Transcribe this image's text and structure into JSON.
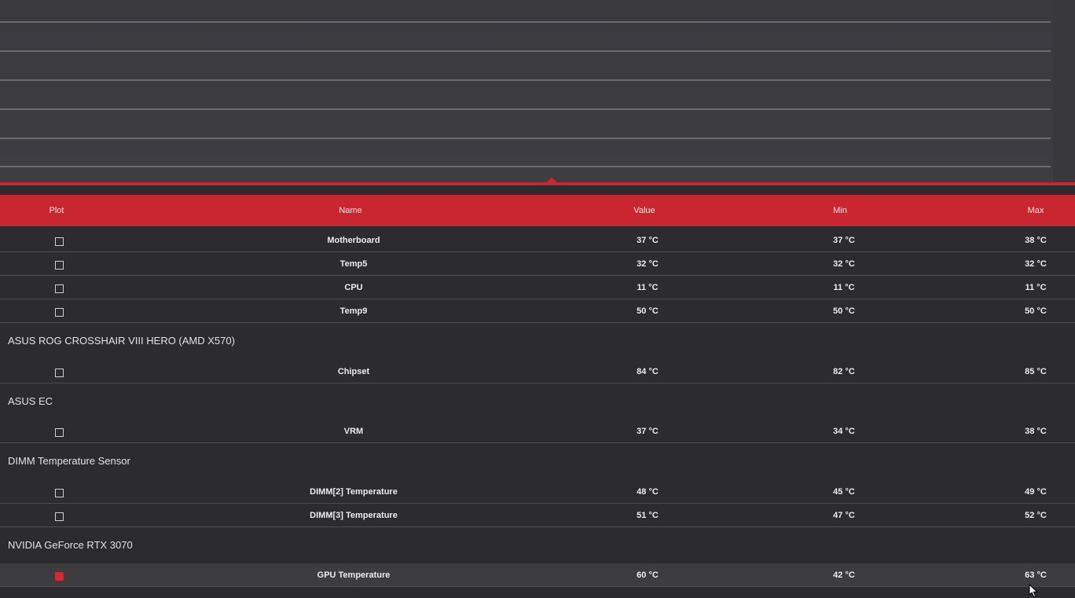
{
  "columns": {
    "plot": "Plot",
    "name": "Name",
    "value": "Value",
    "min": "Min",
    "max": "Max"
  },
  "rows": [
    {
      "name": "Motherboard",
      "value": "37 °C",
      "min": "37 °C",
      "max": "38 °C",
      "plotted": false
    },
    {
      "name": "Temp5",
      "value": "32 °C",
      "min": "32 °C",
      "max": "32 °C",
      "plotted": false
    },
    {
      "name": "CPU",
      "value": "11 °C",
      "min": "11 °C",
      "max": "11 °C",
      "plotted": false
    },
    {
      "name": "Temp9",
      "value": "50 °C",
      "min": "50 °C",
      "max": "50 °C",
      "plotted": false
    }
  ],
  "groups": [
    {
      "title": "ASUS ROG CROSSHAIR VIII HERO (AMD X570)",
      "rows": [
        {
          "name": "Chipset",
          "value": "84 °C",
          "min": "82 °C",
          "max": "85 °C",
          "plotted": false
        }
      ]
    },
    {
      "title": "ASUS EC",
      "rows": [
        {
          "name": "VRM",
          "value": "37 °C",
          "min": "34 °C",
          "max": "38 °C",
          "plotted": false
        }
      ]
    },
    {
      "title": "DIMM Temperature Sensor",
      "rows": [
        {
          "name": "DIMM[2] Temperature",
          "value": "48 °C",
          "min": "45 °C",
          "max": "49 °C",
          "plotted": false
        },
        {
          "name": "DIMM[3] Temperature",
          "value": "51 °C",
          "min": "47 °C",
          "max": "52 °C",
          "plotted": false
        }
      ]
    },
    {
      "title": "NVIDIA GeForce RTX 3070",
      "rows": [
        {
          "name": "GPU Temperature",
          "value": "60 °C",
          "min": "42 °C",
          "max": "63 °C",
          "plotted": true
        }
      ]
    }
  ],
  "colors": {
    "accent": "#c9262f",
    "background": "#2b2b30",
    "graph_background": "#3c3c41",
    "grid": "#6b6b70"
  },
  "icons": {
    "splitter": "diamond-handle-icon",
    "cursor": "mouse-pointer-icon"
  }
}
